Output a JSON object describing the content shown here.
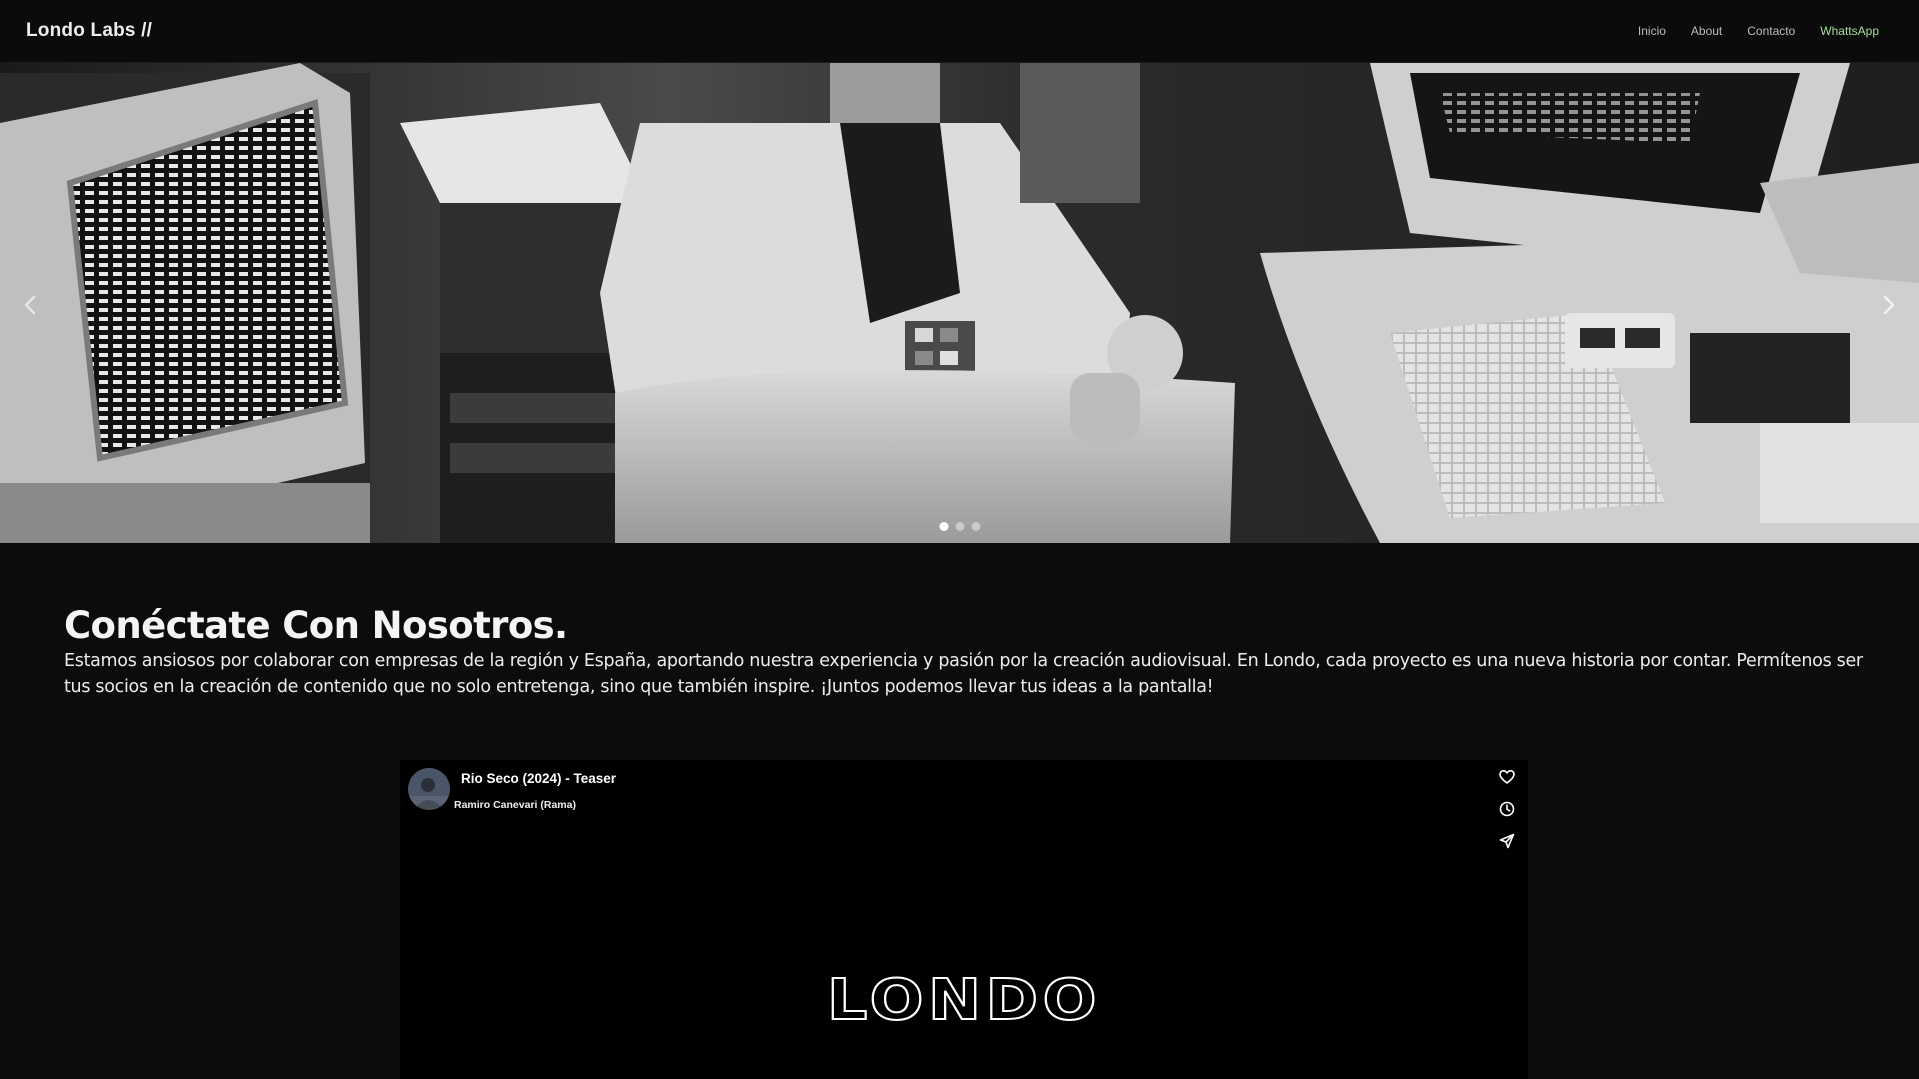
{
  "nav": {
    "brand": "Londo Labs //",
    "links": [
      {
        "label": "Inicio"
      },
      {
        "label": "About"
      },
      {
        "label": "Contacto"
      },
      {
        "label": "WhattsApp"
      }
    ]
  },
  "carousel": {
    "slides_count": 3,
    "active_slide": 1
  },
  "main": {
    "heading": "Conéctate Con Nosotros.",
    "paragraph": "Estamos ansiosos por colaborar con empresas de la región y España, aportando nuestra experiencia y pasión por la creación audiovisual. En Londo, cada proyecto es una nueva historia por contar. Permítenos ser tus socios en la creación de contenido que no solo entretenga, sino que también inspire. ¡Juntos podemos llevar tus ideas a la pantalla!"
  },
  "video": {
    "title": "Rio Seco (2024) - Teaser",
    "author": "Ramiro Canevari (Rama)",
    "logo_text": "LONDO",
    "actions": [
      "heart-icon",
      "clock-icon",
      "send-icon"
    ]
  },
  "colors": {
    "background": "#0c0c0c",
    "whatsapp_link": "#a7df9c"
  }
}
